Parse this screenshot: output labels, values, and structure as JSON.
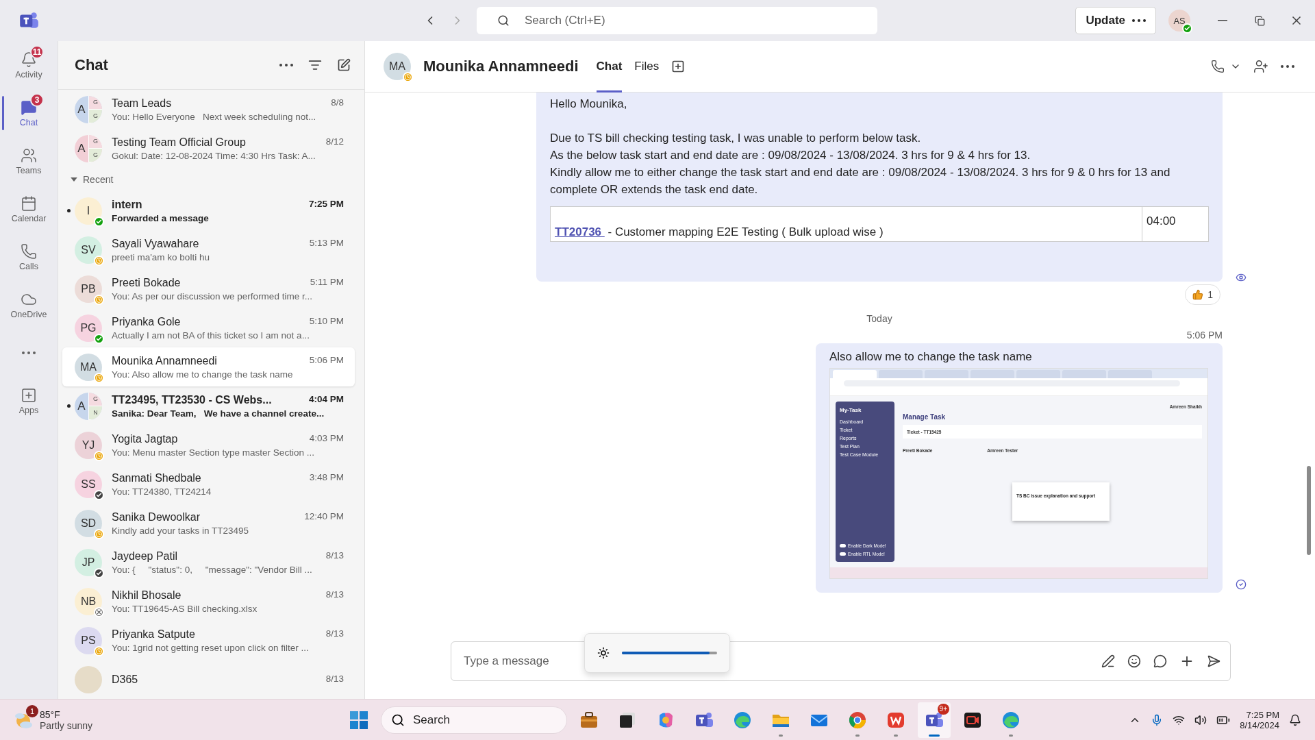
{
  "title_bar": {
    "search": {
      "placeholder": "Search (Ctrl+E)"
    },
    "update_button": "Update",
    "user_avatar": {
      "initials": "AS",
      "status": {
        "kind": "available"
      }
    }
  },
  "rail": [
    {
      "kind": "activity",
      "label": "Activity",
      "badge": "11",
      "selected": false
    },
    {
      "kind": "chat",
      "label": "Chat",
      "badge": "3",
      "selected": true
    },
    {
      "kind": "teams",
      "label": "Teams",
      "selected": false
    },
    {
      "kind": "calendar",
      "label": "Calendar",
      "selected": false
    },
    {
      "kind": "calls",
      "label": "Calls",
      "selected": false
    },
    {
      "kind": "onedrive",
      "label": "OneDrive",
      "selected": false
    },
    {
      "kind": "more",
      "selected": false
    },
    {
      "kind": "apps",
      "label": "Apps",
      "selected": false
    }
  ],
  "chat_list": {
    "title": "Chat",
    "pinned": [
      {
        "name": "Team Leads",
        "time": "8/8",
        "preview": "You: Hello Everyone   Next week scheduling not...",
        "unread": false,
        "selected": false,
        "avatar": {
          "kind": "group",
          "letters": [
            "A",
            "G",
            "G"
          ],
          "color": "#c7d6ec"
        }
      },
      {
        "name": "Testing Team Official Group",
        "time": "8/12",
        "preview": "Gokul: Date: 12-08-2024 Time: 4:30 Hrs Task: A...",
        "unread": false,
        "selected": false,
        "avatar": {
          "kind": "group",
          "letters": [
            "A",
            "G",
            "G"
          ],
          "color": "#f2cfd6"
        }
      }
    ],
    "section": {
      "label": "Recent",
      "expanded": true
    },
    "recent": [
      {
        "name": "intern",
        "time": "7:25 PM",
        "preview": "Forwarded a message",
        "unread": true,
        "selected": false,
        "avatar": {
          "kind": "person",
          "initials": "I",
          "color": "#fbefd3",
          "status": {
            "kind": "available"
          }
        }
      },
      {
        "name": "Sayali Vyawahare",
        "time": "5:13 PM",
        "preview": "preeti ma'am ko bolti hu",
        "unread": false,
        "selected": false,
        "avatar": {
          "kind": "person",
          "initials": "SV",
          "color": "#d3efe2",
          "status": {
            "kind": "away"
          }
        }
      },
      {
        "name": "Preeti Bokade",
        "time": "5:11 PM",
        "preview": "You: As per our discussion we performed time r...",
        "unread": false,
        "selected": false,
        "avatar": {
          "kind": "person",
          "initials": "PB",
          "color": "#ecdcd8",
          "status": {
            "kind": "away"
          }
        }
      },
      {
        "name": "Priyanka Gole",
        "time": "5:10 PM",
        "preview": "Actually I am not BA of this ticket so I am not a...",
        "unread": false,
        "selected": false,
        "avatar": {
          "kind": "person",
          "initials": "PG",
          "color": "#f6d3e0",
          "status": {
            "kind": "available"
          }
        }
      },
      {
        "name": "Mounika Annamneedi",
        "time": "5:06 PM",
        "preview": "You: Also allow me to change the task name",
        "unread": false,
        "selected": true,
        "avatar": {
          "kind": "person",
          "initials": "MA",
          "color": "#d2dde3",
          "status": {
            "kind": "away"
          }
        }
      },
      {
        "name": "TT23495, TT23530 - CS Webs...",
        "time": "4:04 PM",
        "preview": "Sanika: Dear Team,   We have a channel create...",
        "unread": true,
        "selected": false,
        "avatar": {
          "kind": "group",
          "letters": [
            "A",
            "G",
            "N"
          ],
          "color": "#c7d6ec"
        }
      },
      {
        "name": "Yogita Jagtap",
        "time": "4:03 PM",
        "preview": "You: Menu master Section type master Section ...",
        "unread": false,
        "selected": false,
        "avatar": {
          "kind": "person",
          "initials": "YJ",
          "color": "#ecd2d8",
          "status": {
            "kind": "away"
          }
        }
      },
      {
        "name": "Sanmati Shedbale",
        "time": "3:48 PM",
        "preview": "You: TT24380, TT24214",
        "unread": false,
        "selected": false,
        "avatar": {
          "kind": "person",
          "initials": "SS",
          "color": "#f6d3e0",
          "status": {
            "kind": "checked"
          }
        }
      },
      {
        "name": "Sanika Dewoolkar",
        "time": "12:40 PM",
        "preview": "Kindly add your tasks in TT23495",
        "unread": false,
        "selected": false,
        "avatar": {
          "kind": "person",
          "initials": "SD",
          "color": "#d2dde3",
          "status": {
            "kind": "away"
          }
        }
      },
      {
        "name": "Jaydeep Patil",
        "time": "8/13",
        "preview": "You: {     \"status\": 0,     \"message\": \"Vendor Bill ...",
        "unread": false,
        "selected": false,
        "avatar": {
          "kind": "person",
          "initials": "JP",
          "color": "#d3efe2",
          "status": {
            "kind": "checked"
          }
        }
      },
      {
        "name": "Nikhil Bhosale",
        "time": "8/13",
        "preview": "You: TT19645-AS Bill checking.xlsx",
        "unread": false,
        "selected": false,
        "avatar": {
          "kind": "person",
          "initials": "NB",
          "color": "#fbefd3",
          "status": {
            "kind": "offline"
          }
        }
      },
      {
        "name": "Priyanka Satpute",
        "time": "8/13",
        "preview": "You: 1grid not getting reset upon click on filter ...",
        "unread": false,
        "selected": false,
        "avatar": {
          "kind": "person",
          "initials": "PS",
          "color": "#dcdaf0",
          "status": {
            "kind": "away"
          }
        }
      },
      {
        "name": "D365",
        "time": "8/13",
        "unread": false,
        "selected": false
      }
    ]
  },
  "conversation": {
    "avatar": {
      "initials": "MA",
      "status": {
        "kind": "away"
      }
    },
    "name": "Mounika Annamneedi",
    "tabs": [
      {
        "label": "Chat",
        "selected": true
      },
      {
        "label": "Files",
        "selected": false
      }
    ],
    "messages": [
      {
        "kind": "table",
        "lines": [
          "Hello Mounika,",
          "Due to TS bill checking testing task, I was unable to perform below task.",
          "As the below task start and end date are : 09/08/2024 - 13/08/2024. 3 hrs for 9 & 4 hrs for 13.",
          "Kindly allow me to either change the task start and end date are : 09/08/2024 - 13/08/2024. 3 hrs for 9 & 0 hrs for 13 and complete OR extends the task end date."
        ],
        "table": {
          "link": "TT20736 ",
          "rest": "- Customer mapping E2E Testing ( Bulk upload wise )",
          "hours": "04:00"
        },
        "reaction": {
          "count": "1"
        },
        "receipt": {
          "kind": "seen"
        }
      },
      {
        "kind": "divider",
        "label": "Today"
      },
      {
        "kind": "screenshot",
        "time": "5:06 PM",
        "text": "Also allow me to change the task name",
        "receipt": {
          "kind": "sent"
        },
        "screenshot": {
          "sidebar": {
            "title": "My-Task",
            "items": [
              "Dashboard",
              "Ticket",
              "Reports",
              "Test Plan",
              "Test Case Module"
            ],
            "toggles": [
              "Enable Dark Mode!",
              "Enable RTL Mode!"
            ]
          },
          "heading": "Manage Task",
          "ticket": "Ticket - TT15425",
          "user": "Amreen Shaikh",
          "columns": [
            "Preeti Bokade",
            "Amreen Tester"
          ],
          "card": "TS BC issue explanation and support"
        }
      }
    ],
    "composer": {
      "placeholder": "Type a message"
    }
  },
  "brightness_popup": {
    "level": 0.92
  },
  "taskbar": {
    "weather": {
      "badge": "1",
      "temperature": "85°F",
      "condition": "Partly sunny"
    },
    "search": {
      "placeholder": "Search"
    },
    "apps": [
      {
        "kind": "briefcase",
        "running": false,
        "selected": false
      },
      {
        "kind": "task-view",
        "running": false,
        "selected": false
      },
      {
        "kind": "copilot",
        "running": false,
        "selected": false
      },
      {
        "kind": "teams",
        "running": false,
        "selected": false
      },
      {
        "kind": "edge",
        "running": false,
        "selected": false
      },
      {
        "kind": "folder",
        "running": true,
        "selected": false
      },
      {
        "kind": "mail",
        "running": false,
        "selected": false
      },
      {
        "kind": "chrome",
        "running": true,
        "selected": false
      },
      {
        "kind": "office",
        "running": true,
        "selected": false
      },
      {
        "kind": "teams",
        "running": true,
        "selected": true,
        "badge": "9+"
      },
      {
        "kind": "recorder",
        "running": false,
        "selected": false
      },
      {
        "kind": "edge",
        "running": true,
        "selected": false
      }
    ],
    "time": "7:25 PM",
    "date": "8/14/2024"
  }
}
